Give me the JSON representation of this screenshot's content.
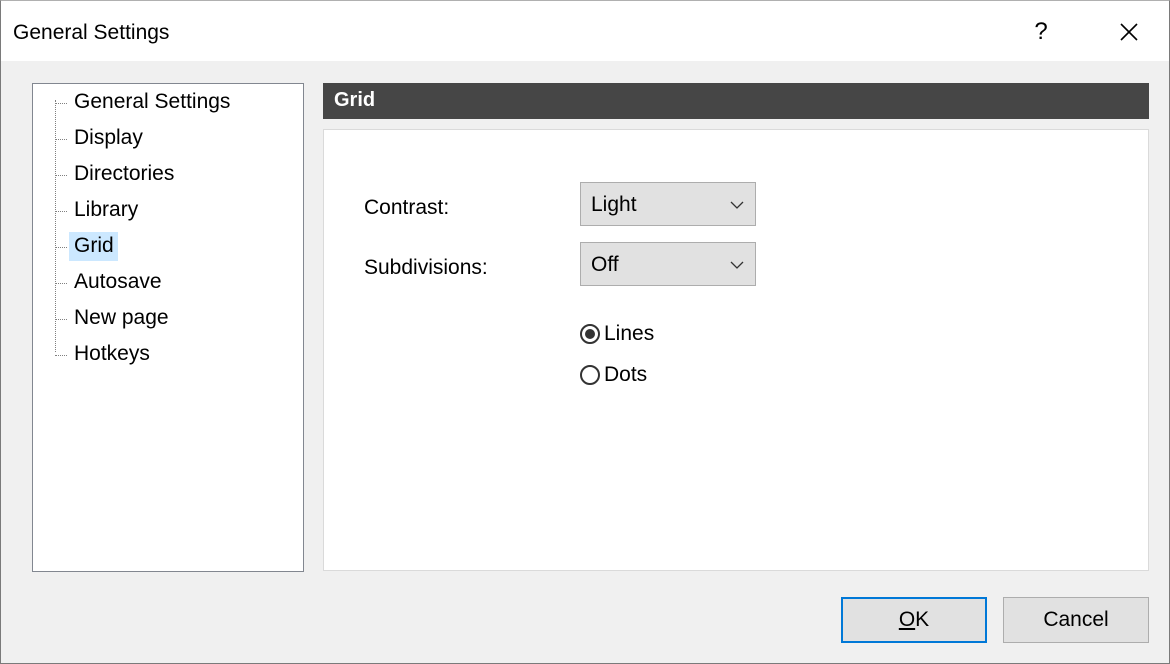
{
  "window": {
    "title": "General Settings",
    "help_label": "?",
    "close_icon": "close-icon"
  },
  "tree": {
    "items": [
      {
        "label": "General Settings",
        "selected": false
      },
      {
        "label": "Display",
        "selected": false
      },
      {
        "label": "Directories",
        "selected": false
      },
      {
        "label": "Library",
        "selected": false
      },
      {
        "label": "Grid",
        "selected": true
      },
      {
        "label": "Autosave",
        "selected": false
      },
      {
        "label": "New page",
        "selected": false
      },
      {
        "label": "Hotkeys",
        "selected": false
      }
    ],
    "selection_color": "#cce8ff"
  },
  "section": {
    "title": "Grid",
    "header_color": "#464646"
  },
  "form": {
    "contrast": {
      "label": "Contrast:",
      "value": "Light"
    },
    "subdivisions": {
      "label": "Subdivisions:",
      "value": "Off"
    },
    "style": {
      "options": [
        {
          "label": "Lines",
          "checked": true
        },
        {
          "label": "Dots",
          "checked": false
        }
      ]
    }
  },
  "buttons": {
    "ok_mnemonic": "O",
    "ok_rest": "K",
    "cancel": "Cancel",
    "default_border_color": "#0078d7"
  }
}
